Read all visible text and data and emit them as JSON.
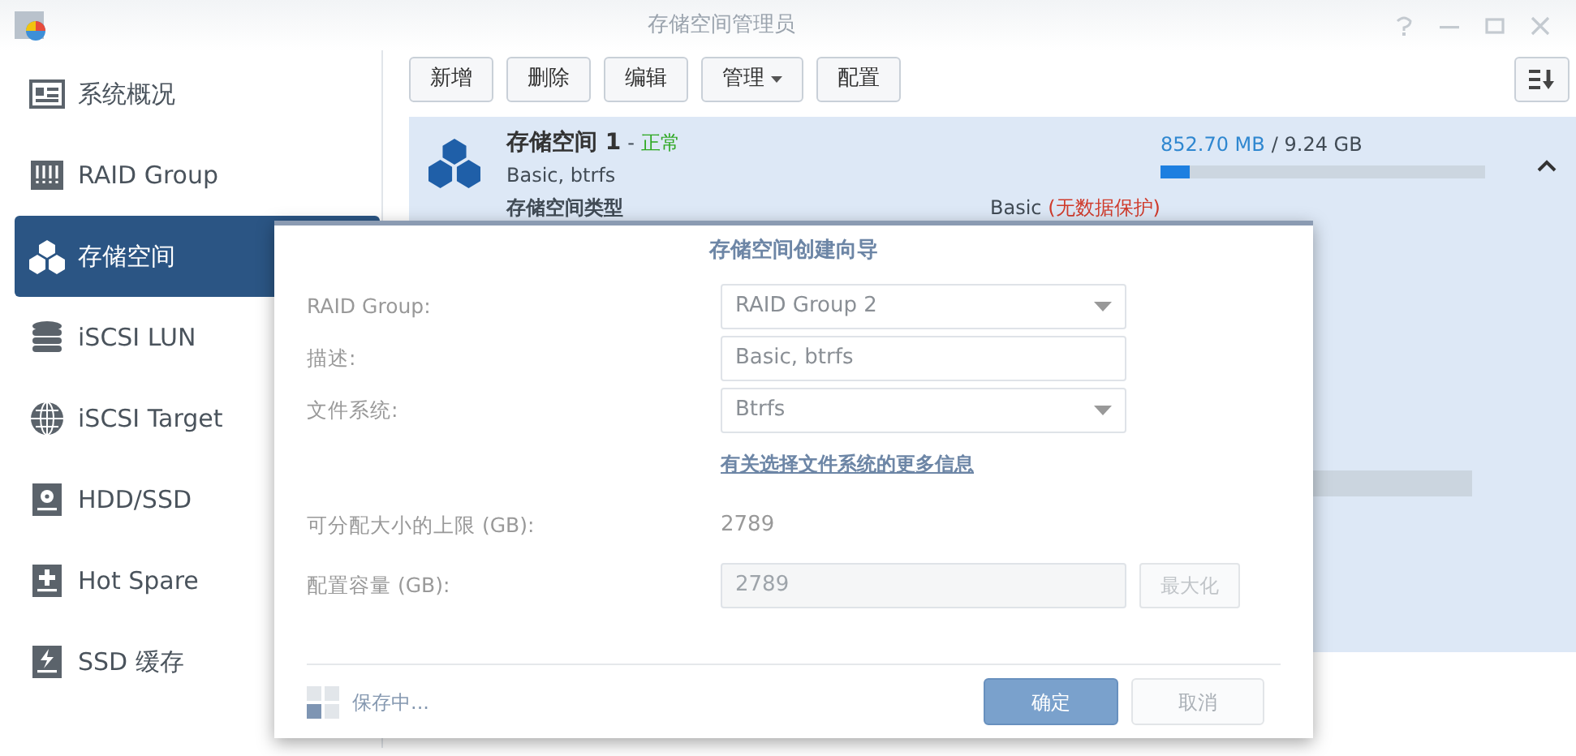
{
  "window": {
    "title": "存储空间管理员"
  },
  "sidebar": {
    "items": [
      {
        "label": "系统概况",
        "selected": false
      },
      {
        "label": "RAID Group",
        "selected": false
      },
      {
        "label": "存储空间",
        "selected": true
      },
      {
        "label": "iSCSI LUN",
        "selected": false
      },
      {
        "label": "iSCSI Target",
        "selected": false
      },
      {
        "label": "HDD/SSD",
        "selected": false
      },
      {
        "label": "Hot Spare",
        "selected": false
      },
      {
        "label": "SSD 缓存",
        "selected": false
      }
    ]
  },
  "toolbar": {
    "buttons": [
      {
        "label": "新增",
        "kind": "button"
      },
      {
        "label": "删除",
        "kind": "button"
      },
      {
        "label": "编辑",
        "kind": "button"
      },
      {
        "label": "管理",
        "kind": "menu"
      },
      {
        "label": "配置",
        "kind": "button"
      }
    ]
  },
  "volume": {
    "name": "存储空间 1",
    "status": "正常",
    "separator": "-",
    "description": "Basic, btrfs",
    "used": "852.70 MB",
    "total": "/ 9.24 GB",
    "level": 0.09,
    "expanded": true,
    "details": [
      {
        "label": "存储空间类型",
        "value": "Basic",
        "note": "(无数据保护)"
      }
    ]
  },
  "wizard": {
    "title": "存储空间创建向导",
    "fields": [
      {
        "kind": "select",
        "label": "RAID Group:",
        "value": "RAID Group 2",
        "disabled": false
      },
      {
        "kind": "input",
        "label": "描述:",
        "value": "Basic, btrfs",
        "disabled": false
      },
      {
        "kind": "select",
        "label": "文件系统:",
        "value": "Btrfs",
        "disabled": false
      },
      {
        "kind": "link",
        "value": "有关选择文件系统的更多信息",
        "disabled": false
      },
      {
        "kind": "readout",
        "label": "可分配大小的上限 (GB):",
        "value": "2789",
        "disabled": false
      },
      {
        "kind": "input",
        "label": "配置容量 (GB):",
        "value": "2789",
        "disabled": true,
        "action": {
          "label": "最大化",
          "disabled": true
        }
      }
    ],
    "status": "保存中...",
    "buttons": [
      {
        "label": "确定",
        "kind": "primary"
      },
      {
        "label": "取消",
        "kind": "secondary"
      }
    ]
  }
}
